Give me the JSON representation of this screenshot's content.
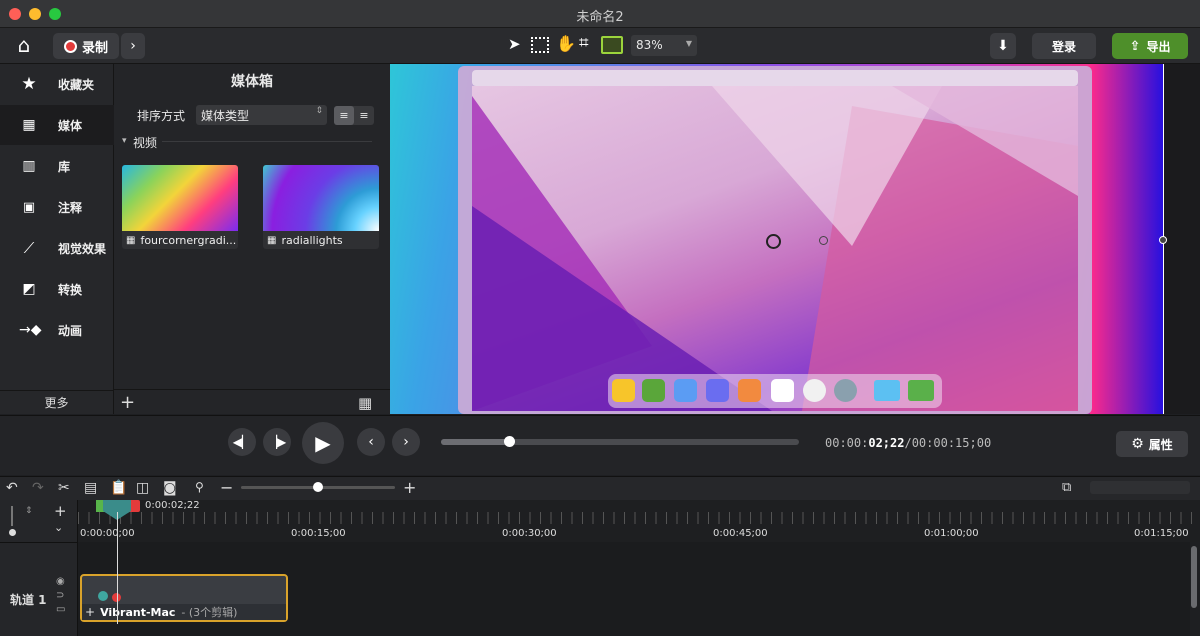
{
  "window": {
    "title": "未命名2"
  },
  "toolbar": {
    "record_label": "录制",
    "zoom_value": "83%",
    "login_label": "登录",
    "export_label": "导出"
  },
  "sidebar": {
    "items": [
      {
        "label": "收藏夹",
        "icon": "star-icon"
      },
      {
        "label": "媒体",
        "icon": "film-icon"
      },
      {
        "label": "库",
        "icon": "library-icon"
      },
      {
        "label": "注释",
        "icon": "annotation-icon"
      },
      {
        "label": "视觉效果",
        "icon": "magic-wand-icon"
      },
      {
        "label": "转换",
        "icon": "transition-icon"
      },
      {
        "label": "动画",
        "icon": "animation-icon"
      }
    ],
    "more_label": "更多"
  },
  "media_bin": {
    "title": "媒体箱",
    "sort_label": "排序方式",
    "sort_value": "媒体类型",
    "section_label": "视频",
    "items": [
      {
        "name": "fourcornergradi..."
      },
      {
        "name": "radiallights"
      }
    ]
  },
  "transport": {
    "time_current_prefix": "00:00:",
    "time_current_bold": "02;22",
    "time_total": "/00:00:15;00",
    "properties_label": "属性",
    "progress": 0.19
  },
  "timeline": {
    "playhead_time": "0:00:02;22",
    "ticks": [
      "0:00:00;00",
      "0:00:15;00",
      "0:00:30;00",
      "0:00:45;00",
      "0:01:00;00",
      "0:01:15;00"
    ],
    "track_label": "轨道 1",
    "clip_name": "Vibrant-Mac",
    "clip_meta": "- (3个剪辑)"
  },
  "colors": {
    "accent_green": "#4e8f2a",
    "clip_border": "#d9a32b",
    "record_red": "#e33b3b"
  }
}
